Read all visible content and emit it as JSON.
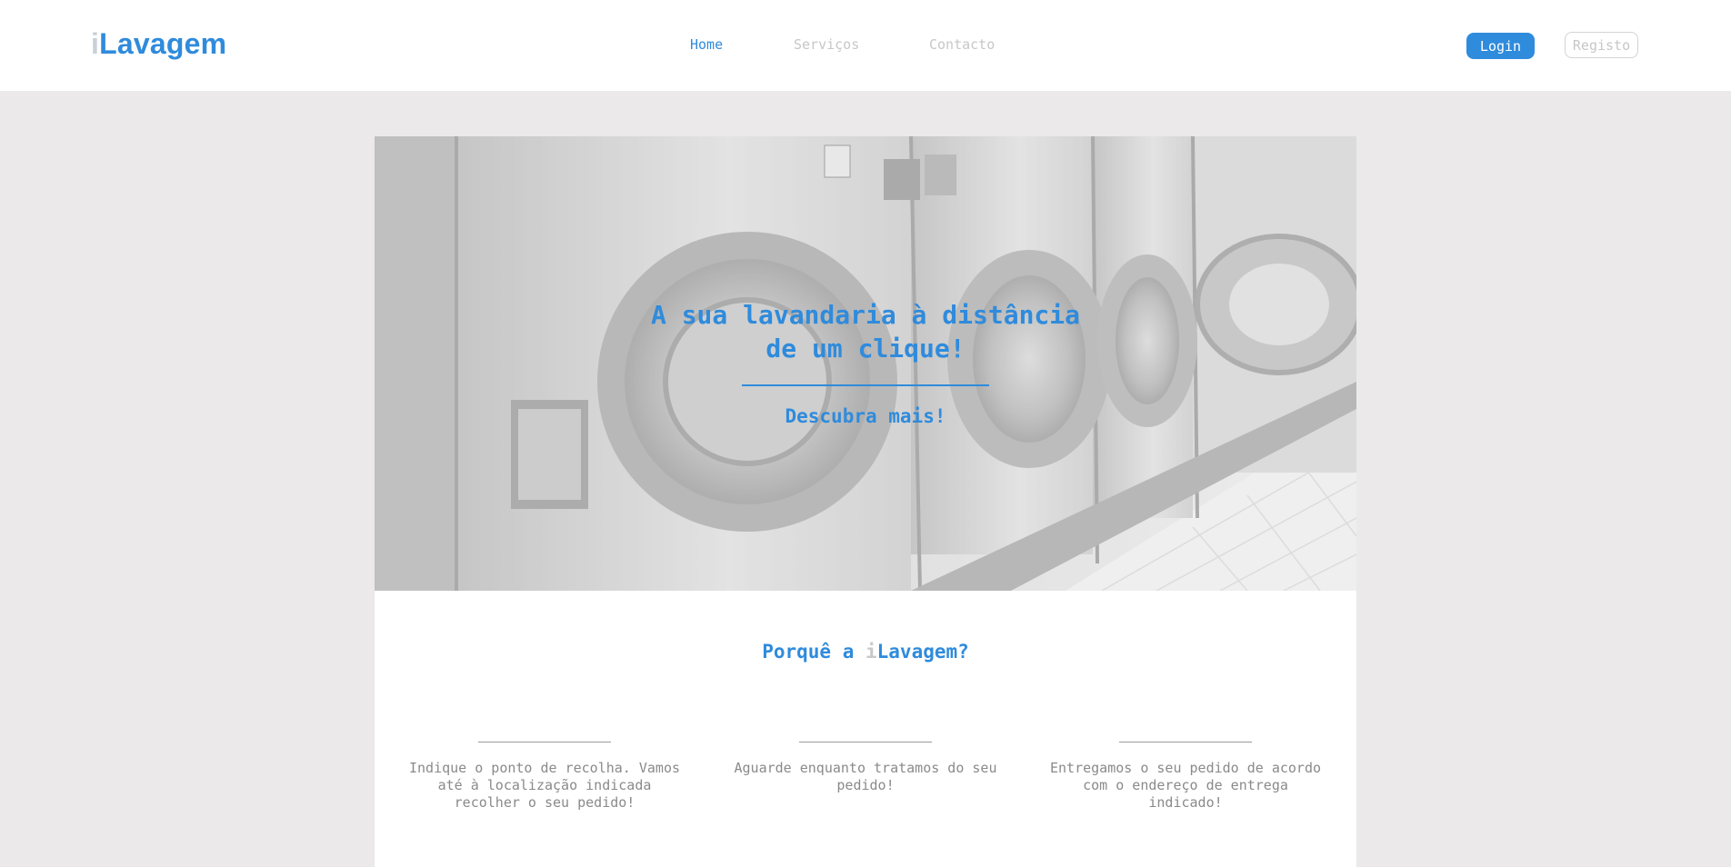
{
  "header": {
    "logo_prefix": "i",
    "logo_text": "Lavagem",
    "nav": [
      {
        "label": "Home",
        "active": true
      },
      {
        "label": "Serviços",
        "active": false
      },
      {
        "label": "Contacto",
        "active": false
      }
    ],
    "login_label": "Login",
    "register_label": "Registo"
  },
  "hero": {
    "title_line1": "A sua lavandaria à distância",
    "title_line2": "de um clique!",
    "cta_label": "Descubra mais!"
  },
  "why": {
    "title_before": "Porquê a ",
    "title_brand_prefix": "i",
    "title_brand_text": "Lavagem?"
  },
  "features": [
    {
      "text": "Indique o ponto de recolha. Vamos até à localização indicada recolher o seu pedido!"
    },
    {
      "text": "Aguarde enquanto tratamos do seu pedido!"
    },
    {
      "text": "Entregamos o seu pedido de acordo com o endereço de entrega indicado!"
    }
  ],
  "colors": {
    "accent": "#2f8bdc",
    "muted": "#c7c7c7",
    "background": "#ebe9e9"
  }
}
